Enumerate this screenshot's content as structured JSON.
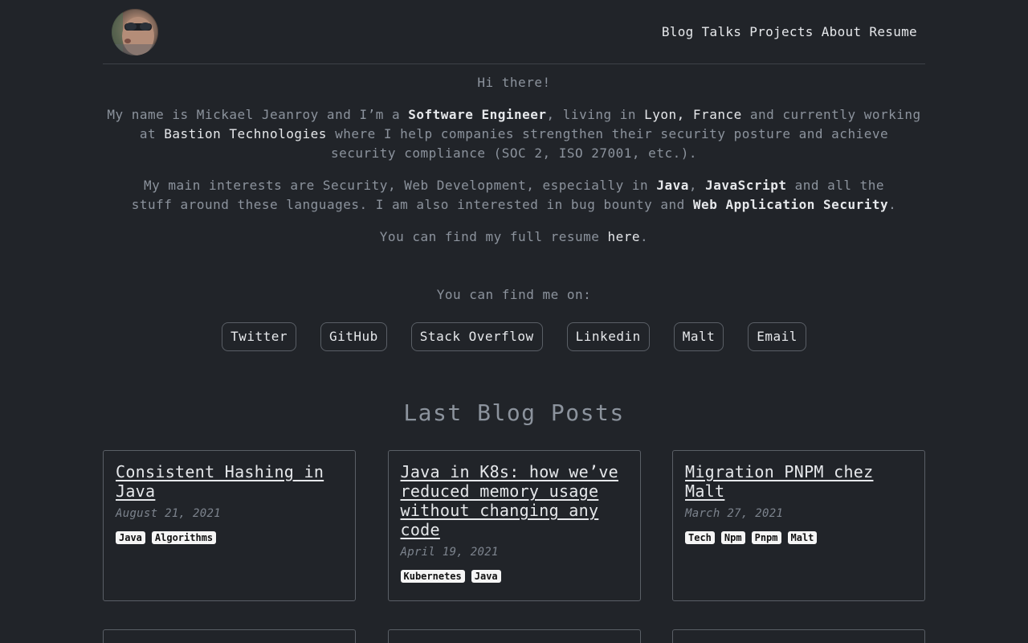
{
  "header": {
    "nav": [
      "Blog",
      "Talks",
      "Projects",
      "About",
      "Resume"
    ]
  },
  "intro": {
    "greeting": "Hi there!",
    "p1": {
      "a": "My name is Mickael Jeanroy and I’m a ",
      "role": "Software Engineer",
      "b": ", living in ",
      "city": "Lyon, France",
      "c": " and currently working at ",
      "company": "Bastion Technologies",
      "d": " where I help companies strengthen their security posture and achieve security compliance (SOC 2, ISO 27001, etc.)."
    },
    "p2": {
      "a": "My main interests are Security, Web Development, especially in ",
      "java": "Java",
      "b": ", ",
      "js": "JavaScript",
      "c": " and all the stuff around these languages. I am also interested in bug bounty and ",
      "was": "Web Application Security",
      "d": "."
    },
    "p3": {
      "a": "You can find my full resume ",
      "link": "here",
      "b": "."
    }
  },
  "social": {
    "label": "You can find me on:",
    "links": [
      "Twitter",
      "GitHub",
      "Stack Overflow",
      "Linkedin",
      "Malt",
      "Email"
    ]
  },
  "blog": {
    "title": "Last Blog Posts",
    "posts": [
      {
        "title": "Consistent Hashing in Java",
        "date": "August 21, 2021",
        "tags": [
          "Java",
          "Algorithms"
        ]
      },
      {
        "title": "Java in K8s: how we’ve reduced memory usage without changing any code",
        "date": "April 19, 2021",
        "tags": [
          "Kubernetes",
          "Java"
        ]
      },
      {
        "title": "Migration PNPM chez Malt",
        "date": "March 27, 2021",
        "tags": [
          "Tech",
          "Npm",
          "Pnpm",
          "Malt"
        ]
      }
    ]
  }
}
